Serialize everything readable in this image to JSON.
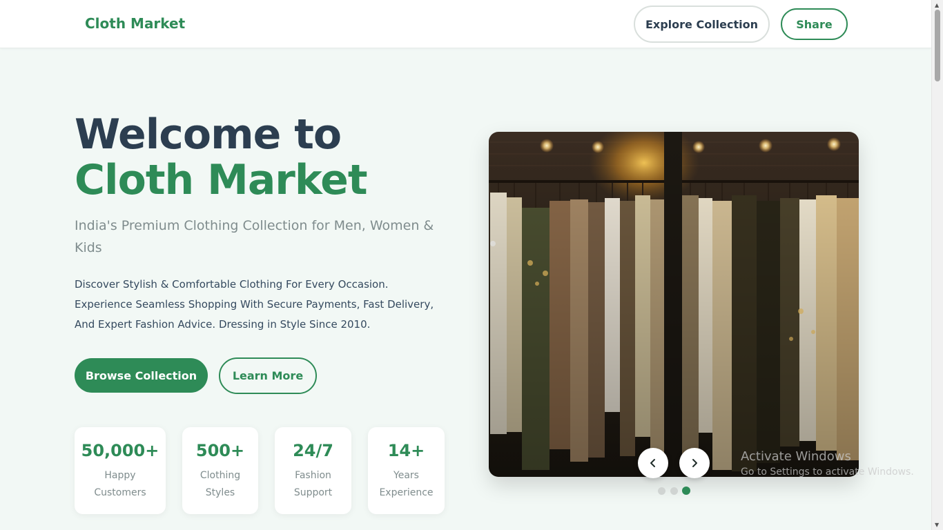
{
  "navbar": {
    "brand": "Cloth Market",
    "explore_label": "Explore Collection",
    "share_label": "Share"
  },
  "hero": {
    "title_line1": "Welcome to",
    "title_line2": "Cloth Market",
    "subtitle": "India's Premium Clothing Collection for Men, Women & Kids",
    "description": "Discover Stylish & Comfortable Clothing For Every Occasion. Experience Seamless Shopping With Secure Payments, Fast Delivery, And Expert Fashion Advice. Dressing in Style Since 2010.",
    "primary_cta": "Browse Collection",
    "secondary_cta": "Learn More"
  },
  "stats": [
    {
      "value": "50,000+",
      "label": "Happy Customers"
    },
    {
      "value": "500+",
      "label": "Clothing Styles"
    },
    {
      "value": "24/7",
      "label": "Fashion Support"
    },
    {
      "value": "14+",
      "label": "Years Experience"
    }
  ],
  "carousel": {
    "slide_count": 3,
    "active_slide": 3,
    "prev_icon": "chevron-left-icon",
    "next_icon": "chevron-right-icon"
  },
  "watermark": {
    "line1": "Activate Windows",
    "line2": "Go to Settings to activate Windows."
  },
  "colors": {
    "brand_green": "#2e8b57",
    "heading_dark": "#2c3e50",
    "muted_text": "#7f8c8d",
    "page_bg": "#f2f8f5"
  }
}
